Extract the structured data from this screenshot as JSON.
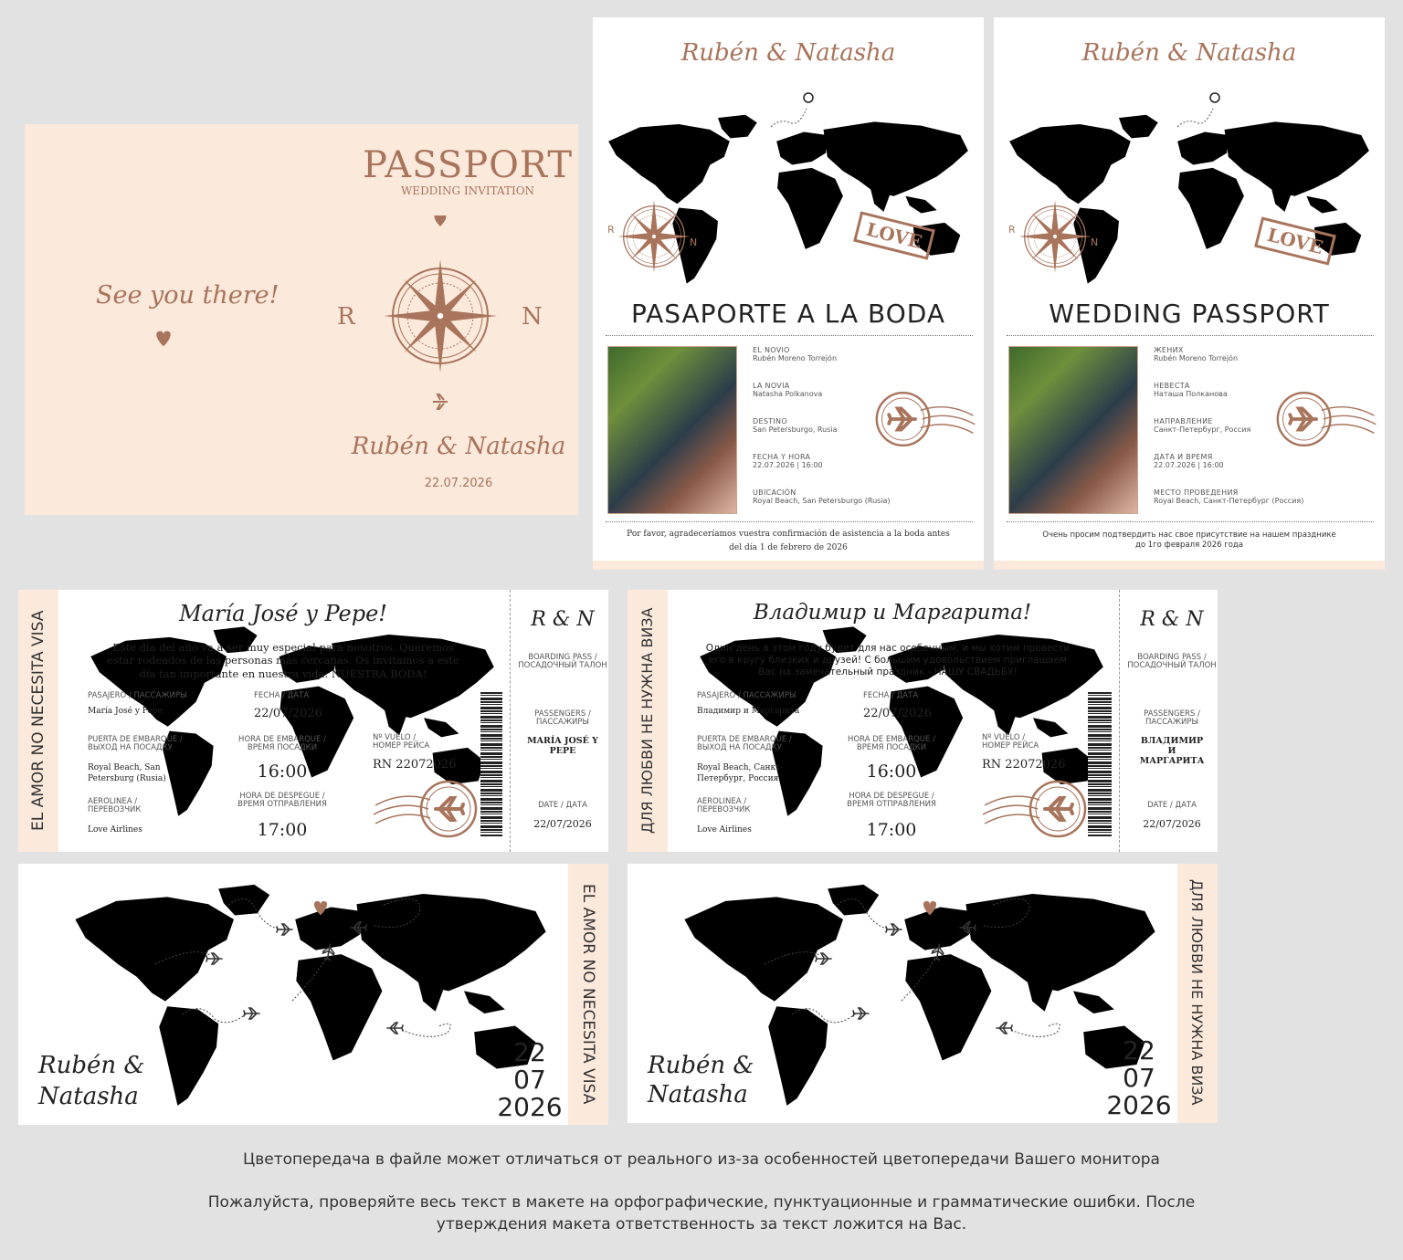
{
  "passport_cover": {
    "title": "PASSPORT",
    "subtitle": "WEDDING INVITATION",
    "see_you": "See you there!",
    "initial_left": "R",
    "initial_right": "N",
    "couple": "Rubén & Natasha",
    "date": "22.07.2026"
  },
  "passport_es": {
    "couple": "Rubén & Natasha",
    "stamp": "LOVE",
    "compass_left": "R",
    "compass_right": "N",
    "title": "PASAPORTE A LA BODA",
    "fields": [
      {
        "label": "EL NOVIO",
        "value": "Rubén Moreno Torrejón"
      },
      {
        "label": "LA NOVIA",
        "value": "Natasha Polkanova"
      },
      {
        "label": "DESTINO",
        "value": "San Petersburgo, Rusia"
      },
      {
        "label": "FECHA Y HORA",
        "value": "22.07.2026 | 16:00"
      },
      {
        "label": "UBICACIÓN",
        "value": "Royal Beach, San Petersburgo (Rusia)"
      }
    ],
    "footer_1": "Por favor, agradeceríamos vuestra confirmación de asistencia a la boda antes",
    "footer_2": "del día 1 de febrero de 2026"
  },
  "passport_ru": {
    "couple": "Rubén & Natasha",
    "stamp": "LOVE",
    "compass_left": "R",
    "compass_right": "N",
    "title": "WEDDING PASSPORT",
    "fields": [
      {
        "label": "ЖЕНИХ",
        "value": "Rubén Moreno Torrejón"
      },
      {
        "label": "НЕВЕСТА",
        "value": "Наташа Полканова"
      },
      {
        "label": "НАПРАВЛЕНИЕ",
        "value": "Санкт-Петербург, Россия"
      },
      {
        "label": "ДАТА И ВРЕМЯ",
        "value": "22.07.2026 | 16:00"
      },
      {
        "label": "МЕСТО ПРОВЕДЕНИЯ",
        "value": "Royal Beach, Санкт-Петербург (Россия)"
      }
    ],
    "footer_1": "Очень просим подтвердить нас свое присутствие на нашем празднике",
    "footer_2": "до 1го февраля 2026 года"
  },
  "ticket_es": {
    "side": "EL AMOR NO NECESITA VISA",
    "greeting": "María José y Pepe!",
    "text": "Este día del año va a ser muy especial para nosotros. Queremos estar rodeados de las personas más cercanas. Os invitamos a este día tan importante en nuestra vida: NUESTRA BODA!",
    "pasajero_lbl": "PASAJERO / ПАССАЖИРЫ",
    "pasajero_val": "María José y Pepe",
    "fecha_lbl": "FECHA / ДАТА",
    "fecha_val": "22/07/2026",
    "puerta_lbl": "PUERTA DE EMBARQUE / ВЫХОД НА ПОСАДКУ",
    "puerta_val": "Royal Beach, San Petersburg (Rusia)",
    "hora_emb_lbl": "HORA DE EMBARQUE / ВРЕМЯ ПОСАДКИ",
    "hora_emb_val": "16:00",
    "vuelo_lbl": "Nº VUELO / НОМЕР РЕЙСА",
    "vuelo_val": "RN 22072026",
    "aero_lbl": "AEROLINEA / ПЕРЕВОЗЧИК",
    "aero_val": "Love Airlines",
    "despegue_lbl": "HORA DE DESPEGUE / ВРЕМЯ ОТПРАВЛЕНИЯ",
    "despegue_val": "17:00",
    "stub_initials": "R & N",
    "stub_bp": "BOARDING PASS / ПОСАДОЧНЫЙ ТАЛОН",
    "stub_pass_lbl": "PASSENGERS / ПАССАЖИРЫ",
    "stub_pass_val": "MARÍA JOSÉ Y PEPE",
    "stub_date_lbl": "DATE / ДАТА",
    "stub_date_val": "22/07/2026"
  },
  "ticket_ru": {
    "side": "ДЛЯ ЛЮБВИ НЕ НУЖНА ВИЗА",
    "greeting": "Владимир и Маргарита!",
    "text": "Один день в этом году будет для нас особенным, и мы хотим провести его в кругу близких и друзей! С большим удовольствием приглашаем Вас на замечательный праздник - НАШУ СВАДЬБУ!",
    "pasajero_lbl": "PASAJERO / ПАССАЖИРЫ",
    "pasajero_val": "Владимир и Маргарита",
    "fecha_lbl": "FECHA / ДАТА",
    "fecha_val": "22/07/2026",
    "puerta_lbl": "PUERTA DE EMBARQUE / ВЫХОД НА ПОСАДКУ",
    "puerta_val": "Royal Beach, Санкт-Петербург, Россия",
    "hora_emb_lbl": "HORA DE EMBARQUE / ВРЕМЯ ПОСАДКИ",
    "hora_emb_val": "16:00",
    "vuelo_lbl": "Nº VUELO / НОМЕР РЕЙСА",
    "vuelo_val": "RN 22072026",
    "aero_lbl": "AEROLINEA / ПЕРЕВОЗЧИК",
    "aero_val": "Love Airlines",
    "despegue_lbl": "HORA DE DESPEGUE / ВРЕМЯ ОТПРАВЛЕНИЯ",
    "despegue_val": "17:00",
    "stub_initials": "R & N",
    "stub_bp": "BOARDING PASS / ПОСАДОЧНЫЙ ТАЛОН",
    "stub_pass_lbl": "PASSENGERS / ПАССАЖИРЫ",
    "stub_pass_val": "ВЛАДИМИР И МАРГАРИТА",
    "stub_date_lbl": "DATE / ДАТА",
    "stub_date_val": "22/07/2026"
  },
  "back_es": {
    "name1": "Rubén &",
    "name2": "Natasha",
    "day": "22",
    "month": "07",
    "year": "2026",
    "side": "EL AMOR NO NECESITA VISA"
  },
  "back_ru": {
    "name1": "Rubén &",
    "name2": "Natasha",
    "day": "22",
    "month": "07",
    "year": "2026",
    "side": "ДЛЯ ЛЮБВИ НЕ НУЖНА ВИЗА"
  },
  "notes": {
    "line1": "Цветопередача в файле может отличаться от реального из-за особенностей цветопередачи Вашего монитора",
    "line2": "Пожалуйста, проверяйте весь текст в макете на орфографические, пунктуационные и грамматические ошибки. После утверждения макета ответственность за текст ложится на Вас."
  },
  "colors": {
    "accent": "#a8745c",
    "cream": "#fbe9dc",
    "map": "#f5e4d3",
    "background": "#e2e2e2"
  }
}
